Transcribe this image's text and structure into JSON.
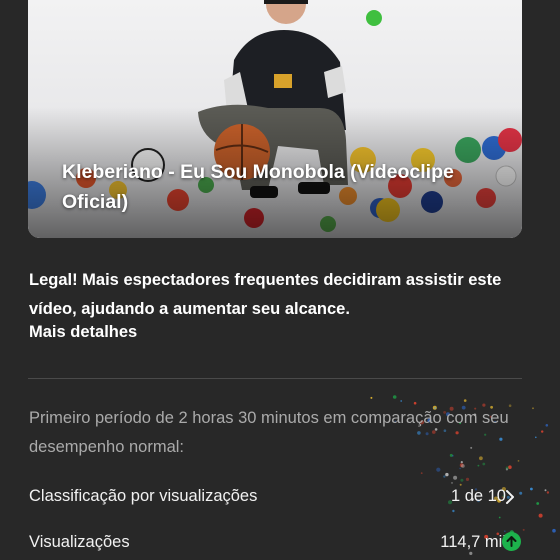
{
  "video": {
    "title": "Kleberiano - Eu Sou Monobola (Videoclipe Oficial)"
  },
  "insight": {
    "message": "Legal! Mais espectadores frequentes decidiram assistir este vídeo, ajudando a aumentar seu alcance.",
    "details_link": "Mais detalhes"
  },
  "comparison": {
    "period_text": "Primeiro período de 2 horas 30 minutos em comparação com seu desempenho normal:"
  },
  "metrics": [
    {
      "label": "Classificação por visualizações",
      "value": "1 de 10",
      "icon": "chevron-right-icon"
    },
    {
      "label": "Visualizações",
      "value": "114,7 mil",
      "icon": "arrow-up-circle-icon"
    }
  ],
  "colors": {
    "background": "#282828",
    "positive": "#1db34c",
    "secondary_text": "#aaaaaa"
  }
}
